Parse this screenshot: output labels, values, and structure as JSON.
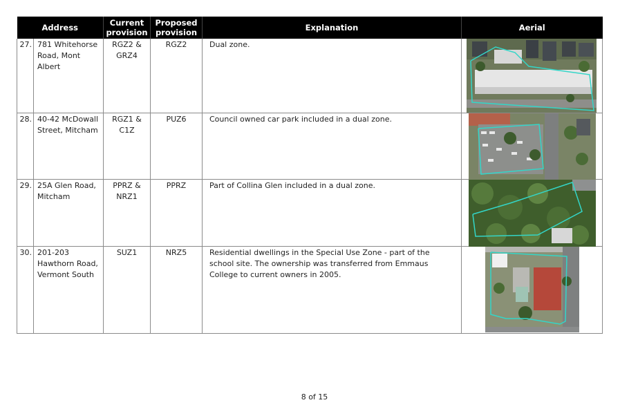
{
  "table": {
    "headers": {
      "address": "Address",
      "current_line1": "Current",
      "current_line2": "provision",
      "proposed_line1": "Proposed",
      "proposed_line2": "provision",
      "explanation": "Explanation",
      "aerial": "Aerial"
    },
    "rows": [
      {
        "number": "27.",
        "address": "781 Whitehorse Road, Mont Albert",
        "current": "RGZ2 & GRZ4",
        "proposed": "RGZ2",
        "explanation": "Dual zone."
      },
      {
        "number": "28.",
        "address": "40-42 McDowall Street, Mitcham",
        "current": "RGZ1 & C1Z",
        "proposed": "PUZ6",
        "explanation": "Council owned car park included in a dual zone."
      },
      {
        "number": "29.",
        "address": "25A Glen Road, Mitcham",
        "current": "PPRZ & NRZ1",
        "proposed": "PPRZ",
        "explanation": "Part of Collina Glen included in a dual zone."
      },
      {
        "number": "30.",
        "address": "201-203 Hawthorn Road, Vermont South",
        "current": "SUZ1",
        "proposed": "NRZ5",
        "explanation": "Residential dwellings in the Special Use Zone - part of the school site. The ownership was transferred from Emmaus College to current owners in 2005."
      }
    ]
  },
  "footer": {
    "page_label": "8 of 15"
  },
  "colors": {
    "header_bg": "#000000",
    "boundary_outline": "#33d6c8"
  }
}
